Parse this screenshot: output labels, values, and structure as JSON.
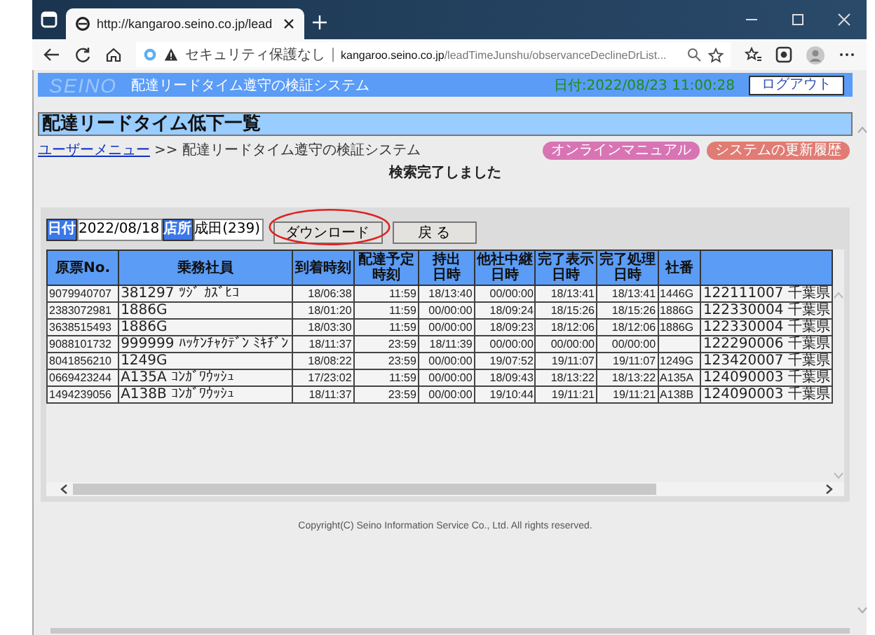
{
  "browser": {
    "tab_title": "http://kangaroo.seino.co.jp/lead",
    "security_label": "セキュリティ保護なし",
    "url_host": "kangaroo.seino.co.jp",
    "url_path": "/leadTimeJunshu/observanceDeclineDrList..."
  },
  "app_header": {
    "logo": "SEINO",
    "system_name": "配達リードタイム遵守の検証システム",
    "datetime": "日付:2022/08/23 11:00:28",
    "logout": "ログアウト"
  },
  "page_title": "配達リードタイム低下一覧",
  "breadcrumb": {
    "link": "ユーザーメニュー",
    "trail": ">> 配達リードタイム遵守の検証システム"
  },
  "header_buttons": [
    {
      "label": "オンラインマニュアル",
      "color": "#d874b4"
    },
    {
      "label": "システムの更新履歴",
      "color": "#e07c74"
    }
  ],
  "status_message": "検索完了しました",
  "filters": [
    {
      "label": "日付",
      "value": "2022/08/18"
    },
    {
      "label": "店所",
      "value": "成田(239)"
    }
  ],
  "actions": [
    {
      "label": "ダウンロード",
      "highlighted": true
    },
    {
      "label": "戻 る",
      "highlighted": false
    }
  ],
  "table": {
    "columns": [
      {
        "label": "原票No.",
        "wrapped": false
      },
      {
        "label": "乗務社員",
        "wrapped": false
      },
      {
        "label": "到着時刻",
        "wrapped": false
      },
      {
        "label": "配達予定時刻",
        "wrapped": true
      },
      {
        "label": "持出日時",
        "wrapped": true
      },
      {
        "label": "他社中継日時",
        "wrapped": true
      },
      {
        "label": "完了表示日時",
        "wrapped": true
      },
      {
        "label": "完了処理日時",
        "wrapped": true
      },
      {
        "label": "社番",
        "wrapped": false
      }
    ],
    "rows": [
      [
        "9079940707",
        "381297 ﾂｼﾞ ｶｽﾞﾋｺ",
        "18/06:38",
        "11:59",
        "18/13:40",
        "00/00:00",
        "18/13:41",
        "18/13:41",
        "1446G",
        "122111007 千葉県"
      ],
      [
        "2383072981",
        "1886G",
        "18/01:20",
        "11:59",
        "00/00:00",
        "18/09:24",
        "18/15:26",
        "18/15:26",
        "1886G",
        "122330004 千葉県"
      ],
      [
        "3638515493",
        "1886G",
        "18/03:30",
        "11:59",
        "00/00:00",
        "18/09:23",
        "18/12:06",
        "18/12:06",
        "1886G",
        "122330004 千葉県"
      ],
      [
        "9088101732",
        "999999 ﾊｯｹﾝﾁｬｸﾃﾞﾝ ﾐｷﾁﾞﾝ",
        "18/11:37",
        "23:59",
        "18/11:39",
        "00/00:00",
        "00/00:00",
        "00/00:00",
        null,
        "122290006 千葉県"
      ],
      [
        "8041856210",
        "1249G",
        "18/08:22",
        "23:59",
        "00/00:00",
        "19/07:52",
        "19/11:07",
        "19/11:07",
        "1249G",
        "123420007 千葉県"
      ],
      [
        "0669423244",
        "A135A ｺﾝｶﾞﾜｳｯｼｭ",
        "17/23:02",
        "11:59",
        "00/00:00",
        "18/09:43",
        "18/13:22",
        "18/13:22",
        "A135A",
        "124090003 千葉県"
      ],
      [
        "1494239056",
        "A138B ｺﾝｶﾞﾜｳｯｼｭ",
        "18/11:37",
        "23:59",
        "00/00:00",
        "19/10:44",
        "19/11:21",
        "19/11:21",
        "A138B",
        "124090003 千葉県"
      ]
    ]
  },
  "copyright": "Copyright(C) Seino Information Service Co., Ltd. All rights reserved."
}
